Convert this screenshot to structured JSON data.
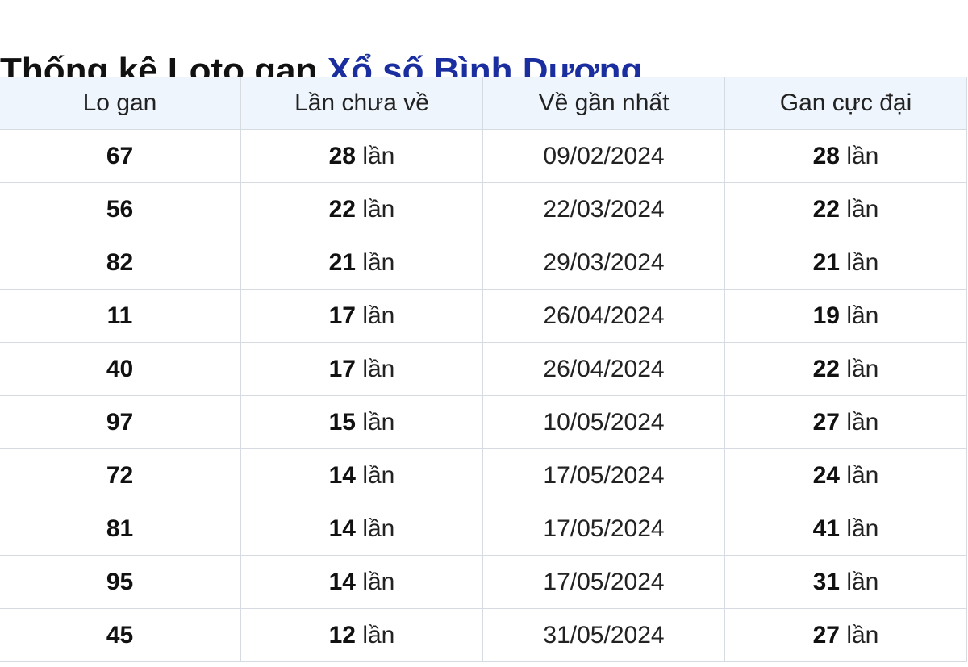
{
  "title": {
    "prefix": "Thống kê Loto gan ",
    "link": "Xổ số Bình Dương"
  },
  "table": {
    "headers": [
      "Lo gan",
      "Lần chưa về",
      "Về gần nhất",
      "Gan cực đại"
    ],
    "unit": "lần",
    "rows": [
      {
        "lo": "67",
        "chua_ve": "28",
        "gan_nhat": "09/02/2024",
        "cuc_dai": "28"
      },
      {
        "lo": "56",
        "chua_ve": "22",
        "gan_nhat": "22/03/2024",
        "cuc_dai": "22"
      },
      {
        "lo": "82",
        "chua_ve": "21",
        "gan_nhat": "29/03/2024",
        "cuc_dai": "21"
      },
      {
        "lo": "11",
        "chua_ve": "17",
        "gan_nhat": "26/04/2024",
        "cuc_dai": "19"
      },
      {
        "lo": "40",
        "chua_ve": "17",
        "gan_nhat": "26/04/2024",
        "cuc_dai": "22"
      },
      {
        "lo": "97",
        "chua_ve": "15",
        "gan_nhat": "10/05/2024",
        "cuc_dai": "27"
      },
      {
        "lo": "72",
        "chua_ve": "14",
        "gan_nhat": "17/05/2024",
        "cuc_dai": "24"
      },
      {
        "lo": "81",
        "chua_ve": "14",
        "gan_nhat": "17/05/2024",
        "cuc_dai": "41"
      },
      {
        "lo": "95",
        "chua_ve": "14",
        "gan_nhat": "17/05/2024",
        "cuc_dai": "31"
      },
      {
        "lo": "45",
        "chua_ve": "12",
        "gan_nhat": "31/05/2024",
        "cuc_dai": "27"
      }
    ]
  },
  "colors": {
    "title_link": "#1a2ea0",
    "date_text": "#1f3a93",
    "header_bg": "#eef5fd",
    "border": "#d6dbe2"
  }
}
